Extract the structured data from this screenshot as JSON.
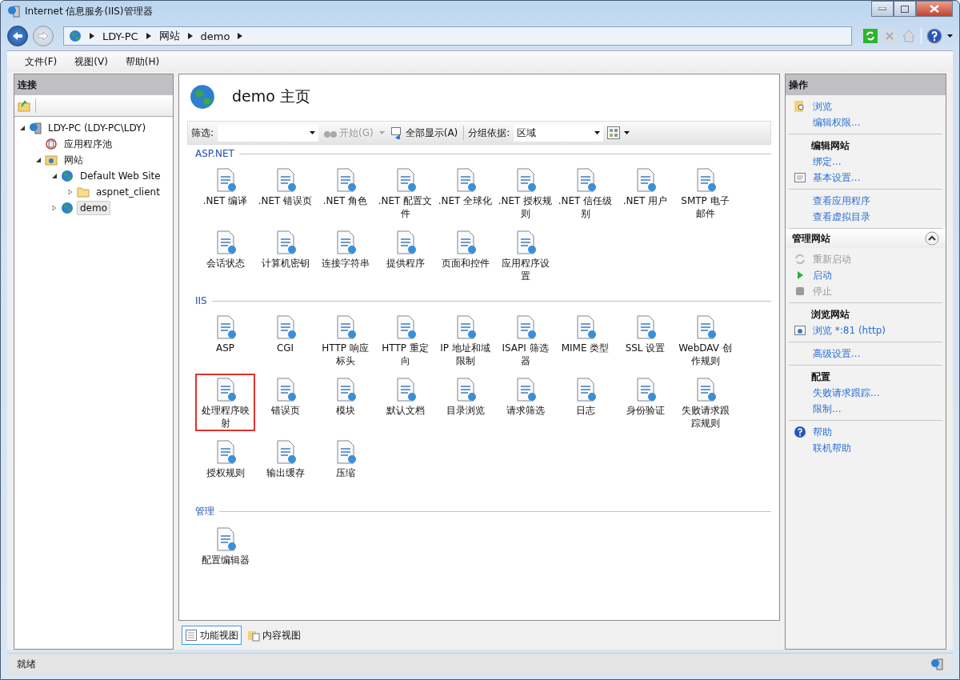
{
  "window": {
    "title": "Internet 信息服务(IIS)管理器"
  },
  "address": {
    "crumbs": [
      "LDY-PC",
      "网站",
      "demo"
    ]
  },
  "menu": [
    "文件(F)",
    "视图(V)",
    "帮助(H)"
  ],
  "connections": {
    "title": "连接",
    "tree": [
      {
        "label": "LDY-PC (LDY-PC\\LDY)",
        "kind": "server",
        "expanded": true,
        "selected": false,
        "children": [
          {
            "label": "应用程序池",
            "kind": "pool",
            "selected": false
          },
          {
            "label": "网站",
            "kind": "sites",
            "expanded": true,
            "selected": false,
            "children": [
              {
                "label": "Default Web Site",
                "kind": "site",
                "expanded": true,
                "selected": false,
                "children": [
                  {
                    "label": "aspnet_client",
                    "kind": "folder",
                    "expanded": false,
                    "selected": false
                  }
                ]
              },
              {
                "label": "demo",
                "kind": "site",
                "expanded": false,
                "selected": true
              }
            ]
          }
        ]
      }
    ]
  },
  "center": {
    "title": "demo 主页",
    "filter": {
      "label": "筛选:",
      "go": "开始(G)",
      "show_all": "全部显示(A)",
      "group_label": "分组依据:",
      "group_value": "区域"
    },
    "groups": [
      {
        "name": "ASP.NET",
        "items": [
          {
            "label": ".NET 编译",
            "selected": false
          },
          {
            "label": ".NET 错误页",
            "selected": false
          },
          {
            "label": ".NET 角色",
            "selected": false
          },
          {
            "label": ".NET 配置文件",
            "selected": false
          },
          {
            "label": ".NET 全球化",
            "selected": false
          },
          {
            "label": ".NET 授权规则",
            "selected": false
          },
          {
            "label": ".NET 信任级别",
            "selected": false
          },
          {
            "label": ".NET 用户",
            "selected": false
          },
          {
            "label": "SMTP 电子邮件",
            "selected": false
          },
          {
            "label": "会话状态",
            "selected": false
          },
          {
            "label": "计算机密钥",
            "selected": false
          },
          {
            "label": "连接字符串",
            "selected": false
          },
          {
            "label": "提供程序",
            "selected": false
          },
          {
            "label": "页面和控件",
            "selected": false
          },
          {
            "label": "应用程序设置",
            "selected": false
          }
        ]
      },
      {
        "name": "IIS",
        "items": [
          {
            "label": "ASP",
            "selected": false
          },
          {
            "label": "CGI",
            "selected": false
          },
          {
            "label": "HTTP 响应标头",
            "selected": false
          },
          {
            "label": "HTTP 重定向",
            "selected": false
          },
          {
            "label": "IP 地址和域限制",
            "selected": false
          },
          {
            "label": "ISAPI 筛选器",
            "selected": false
          },
          {
            "label": "MIME 类型",
            "selected": false
          },
          {
            "label": "SSL 设置",
            "selected": false
          },
          {
            "label": "WebDAV 创作规则",
            "selected": false
          },
          {
            "label": "处理程序映射",
            "selected": true
          },
          {
            "label": "错误页",
            "selected": false
          },
          {
            "label": "模块",
            "selected": false
          },
          {
            "label": "默认文档",
            "selected": false
          },
          {
            "label": "目录浏览",
            "selected": false
          },
          {
            "label": "请求筛选",
            "selected": false
          },
          {
            "label": "日志",
            "selected": false
          },
          {
            "label": "身份验证",
            "selected": false
          },
          {
            "label": "失败请求跟踪规则",
            "selected": false
          },
          {
            "label": "授权规则",
            "selected": false
          },
          {
            "label": "输出缓存",
            "selected": false
          },
          {
            "label": "压缩",
            "selected": false
          }
        ]
      },
      {
        "name": "管理",
        "items": [
          {
            "label": "配置编辑器",
            "selected": false
          }
        ]
      }
    ],
    "view_tabs": [
      {
        "label": "功能视图",
        "selected": true
      },
      {
        "label": "内容视图",
        "selected": false
      }
    ]
  },
  "actions": {
    "title": "操作",
    "blocks": [
      {
        "kind": "group",
        "items": [
          {
            "label": "浏览",
            "kind": "browse",
            "disabled": false
          },
          {
            "label": "编辑权限...",
            "kind": "plain",
            "disabled": false
          }
        ]
      },
      {
        "kind": "group",
        "heading": "编辑网站",
        "items": [
          {
            "label": "绑定...",
            "kind": "plain",
            "disabled": false
          },
          {
            "label": "基本设置...",
            "kind": "settings",
            "disabled": false
          }
        ]
      },
      {
        "kind": "group",
        "items": [
          {
            "label": "查看应用程序",
            "kind": "plain",
            "disabled": false
          },
          {
            "label": "查看虚拟目录",
            "kind": "plain",
            "disabled": false
          }
        ]
      },
      {
        "kind": "band",
        "title": "管理网站"
      },
      {
        "kind": "group",
        "items": [
          {
            "label": "重新启动",
            "kind": "restart",
            "disabled": true
          },
          {
            "label": "启动",
            "kind": "start",
            "disabled": false
          },
          {
            "label": "停止",
            "kind": "stop",
            "disabled": true
          }
        ]
      },
      {
        "kind": "group",
        "heading": "浏览网站",
        "items": [
          {
            "label": "浏览 *:81 (http)",
            "kind": "site",
            "disabled": false
          }
        ]
      },
      {
        "kind": "group",
        "items": [
          {
            "label": "高级设置...",
            "kind": "plain",
            "disabled": false
          }
        ]
      },
      {
        "kind": "group",
        "heading": "配置",
        "items": [
          {
            "label": "失败请求跟踪...",
            "kind": "plain",
            "disabled": false
          },
          {
            "label": "限制...",
            "kind": "plain",
            "disabled": false
          }
        ]
      },
      {
        "kind": "group",
        "items": [
          {
            "label": "帮助",
            "kind": "help",
            "disabled": false
          },
          {
            "label": "联机帮助",
            "kind": "plain",
            "disabled": false
          }
        ]
      }
    ]
  },
  "status_bar": "就绪"
}
